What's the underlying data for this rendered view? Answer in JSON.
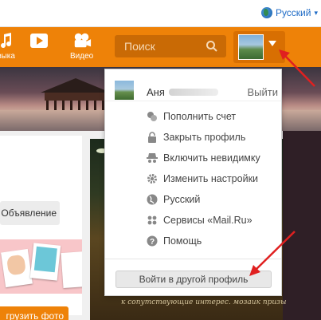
{
  "topbar": {
    "language": "Русский",
    "language_icon": "globe-icon"
  },
  "nav": {
    "music_label_partial": "зыка",
    "video_label": "Видео",
    "search_placeholder": "Поиск"
  },
  "sidebar": {
    "ad_label": "Объявление",
    "upload_label": "грузить фото"
  },
  "feed": {
    "caption": "к сопутствующие интерес. мозаик призы"
  },
  "menu": {
    "user_name": "Аня",
    "logout_label": "Выйти",
    "items": [
      {
        "icon": "coins-icon",
        "label": "Пополнить счет"
      },
      {
        "icon": "lock-icon",
        "label": "Закрыть профиль"
      },
      {
        "icon": "incognito-icon",
        "label": "Включить невидимку"
      },
      {
        "icon": "gear-icon",
        "label": "Изменить настройки"
      },
      {
        "icon": "globe-icon",
        "label": "Русский"
      },
      {
        "icon": "grid-icon",
        "label": "Сервисы «Mail.Ru»"
      },
      {
        "icon": "help-icon",
        "label": "Помощь"
      }
    ],
    "switch_profile_label": "Войти в другой профиль"
  },
  "colors": {
    "accent": "#ee8208",
    "annotation_arrow": "#e02020"
  }
}
